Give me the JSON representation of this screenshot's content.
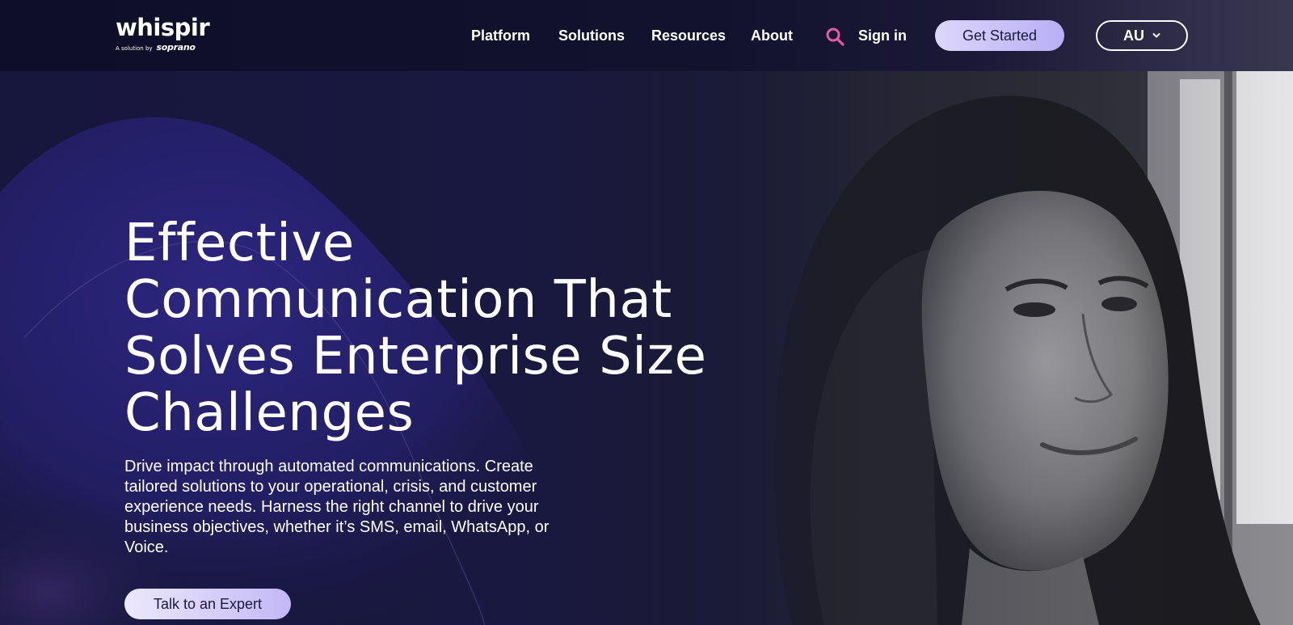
{
  "header": {
    "logo": {
      "word": "whispir",
      "sub_small": "A solution by",
      "sub_brand": "soprano"
    },
    "nav": [
      "Platform",
      "Solutions",
      "Resources",
      "About"
    ],
    "search_icon": "search-icon",
    "sign_in": "Sign in",
    "get_started": "Get Started",
    "region": "AU",
    "colors": {
      "accent_pink": "#e85aa7",
      "button_lavender": "#c9bff8"
    }
  },
  "hero": {
    "title": "Effective Communication That Solves Enterprise Size Challenges",
    "body": "Drive impact through automated communications. Create tailored solutions to your operational, crisis, and customer experience needs. Harness the right channel to drive your business objectives, whether it’s SMS, email, WhatsApp, or Voice.",
    "cta": "Talk to an Expert"
  }
}
